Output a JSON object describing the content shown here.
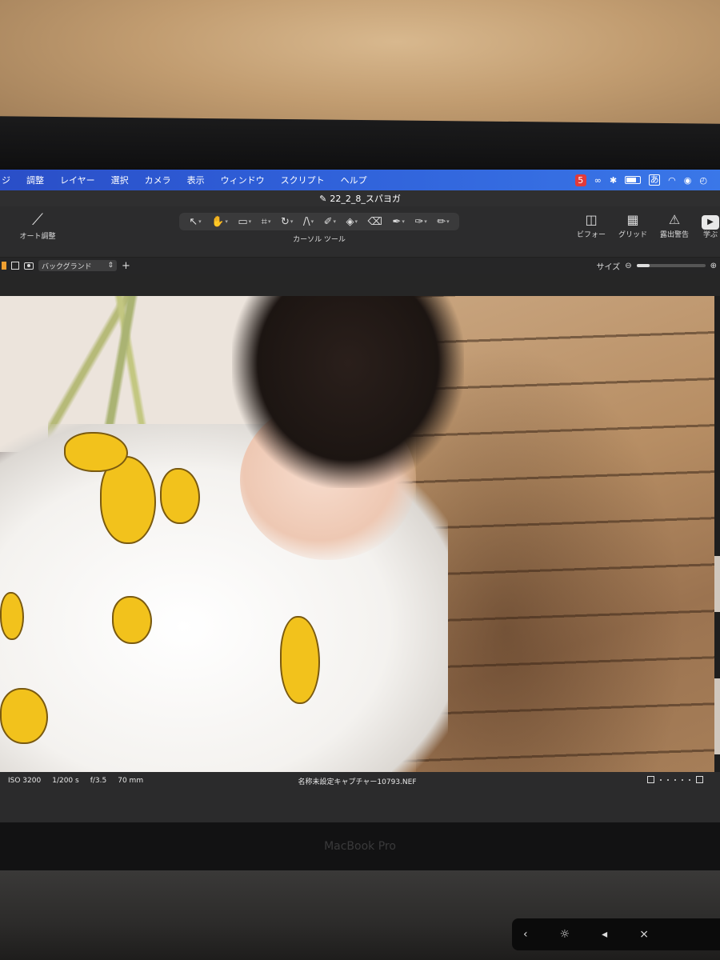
{
  "menubar": {
    "items": [
      "ジ",
      "調整",
      "レイヤー",
      "選択",
      "カメラ",
      "表示",
      "ウィンドウ",
      "スクリプト",
      "ヘルプ"
    ],
    "status_icons": [
      "html5-icon",
      "creative-cloud-icon",
      "bluetooth-icon",
      "battery-icon",
      "input-method-icon",
      "wifi-icon",
      "user-icon",
      "time-machine-icon"
    ],
    "input_method": "あ"
  },
  "window": {
    "title": "22_2_8_スパヨガ"
  },
  "toolbar": {
    "auto_adjust_label": "オート調整",
    "cursor_tools_label": "カーソル ツール",
    "before_label": "ビフォー",
    "grid_label": "グリッド",
    "exposure_warning_label": "露出警告",
    "learn_label": "学ぶ"
  },
  "viewbar": {
    "layer": "バックグランド",
    "size_label": "サイズ"
  },
  "status": {
    "iso": "ISO 3200",
    "shutter": "1/200 s",
    "aperture": "f/3.5",
    "focal_length": "70 mm",
    "filename": "名称未設定キャプチャー10793.NEF"
  },
  "device": {
    "label": "MacBook Pro"
  },
  "colors": {
    "menubar_blue": "#2f5fd8",
    "accent_orange": "#f0a030"
  }
}
